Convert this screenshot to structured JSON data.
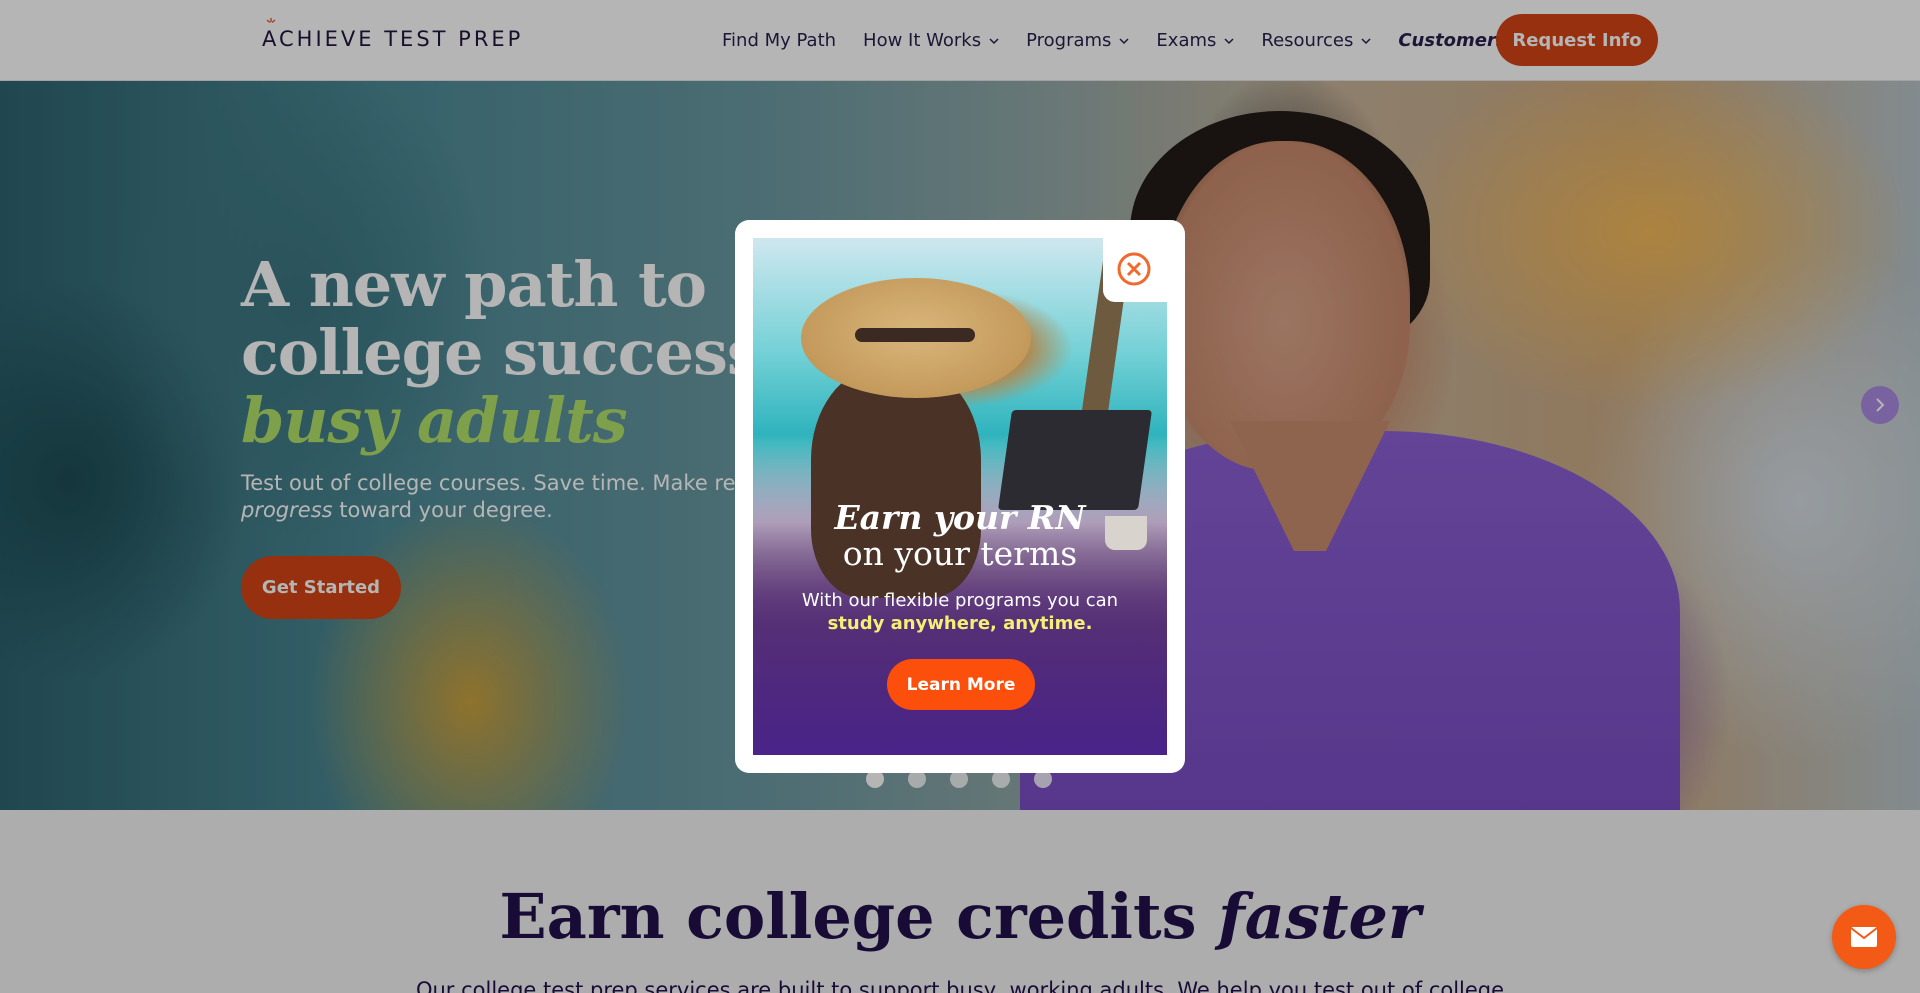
{
  "header": {
    "logo_text": "ACHIEVE TEST PREP",
    "nav": [
      {
        "label": "Find My Path",
        "has_dropdown": false
      },
      {
        "label": "How It Works",
        "has_dropdown": true
      },
      {
        "label": "Programs",
        "has_dropdown": true
      },
      {
        "label": "Exams",
        "has_dropdown": true
      },
      {
        "label": "Resources",
        "has_dropdown": true
      },
      {
        "label": "Customers",
        "has_dropdown": true
      }
    ],
    "cta_label": "Request Info"
  },
  "hero": {
    "title_line1": "A new path to",
    "title_line2": "college success for",
    "title_line3": "busy adults",
    "subtitle_part1": "Test out of college courses. Save time. Make real",
    "subtitle_italic": "progress",
    "subtitle_part2": "toward your degree.",
    "button_label": "Get Started",
    "slide_count": 5,
    "active_slide": 1
  },
  "modal": {
    "heading_italic": "Earn your RN",
    "heading_rest": "on your terms",
    "body_line1": "With our flexible programs you can",
    "body_highlight": "study anywhere, anytime.",
    "button_label": "Learn More",
    "close_icon": "close-circle-icon"
  },
  "section": {
    "title_plain": "Earn college credits",
    "title_italic": "faster",
    "body": "Our college test prep services are built to support busy, working adults. We help you test out of college"
  },
  "colors": {
    "brand_orange": "#d34414",
    "accent_green": "#b4e26a",
    "navy": "#22114d",
    "highlight_yellow": "#f4f076",
    "mail_button": "#f25a16"
  }
}
